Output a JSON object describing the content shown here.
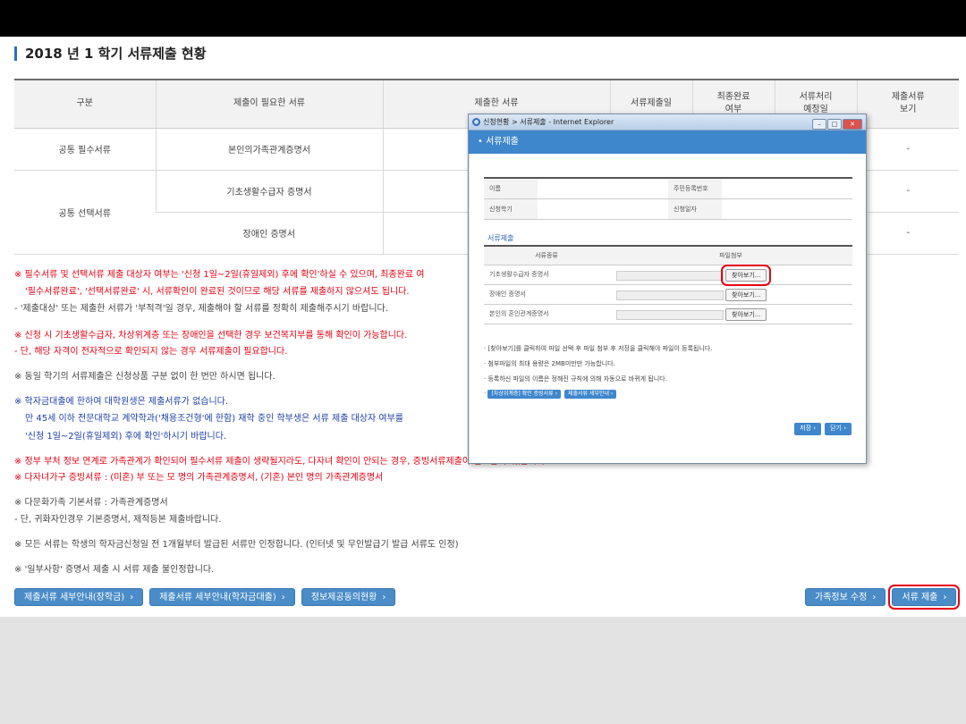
{
  "page": {
    "title": "2018 년 1 학기 서류제출 현황"
  },
  "table": {
    "headers": [
      "구분",
      "제출이 필요한 서류",
      "제출한 서류",
      "서류제출일",
      "최종완료\n여부",
      "서류처리\n예정일",
      "제출서류\n보기"
    ],
    "rows": [
      {
        "group": "공통 필수서류",
        "doc": "본인의가족관계증명서",
        "view": "-"
      },
      {
        "group": "공통 선택서류",
        "doc": "기초생활수급자 증명서",
        "view": "-"
      },
      {
        "group": "",
        "doc": "장애인 증명서",
        "view": "-"
      }
    ]
  },
  "notes": [
    {
      "text": "※ 필수서류 및 선택서류 제출 대상자 여부는 '신청 1일~2일(휴일제외) 후에 확인'하실 수 있으며, 최종완료 여",
      "color": "red"
    },
    {
      "text": "'필수서류완료', '선택서류완료' 시, 서류확인이 완료된 것이므로 해당 서류를 제출하지 않으셔도 됩니다.",
      "color": "red"
    },
    {
      "text": "- '제출대상' 또는 제출한 서류가 '부적격'일 경우, 제출해야 할 서류를 정확히 제출해주시기 바랍니다.",
      "color": "dark"
    },
    {
      "text": "※ 신청 시 기초생활수급자, 차상위계층 또는 장애인을 선택한 경우 보건복지부를 통해 확인이 가능합니다.",
      "color": "red"
    },
    {
      "text": "- 단, 해당 자격이 전자적으로 확인되지 않는 경우 서류제출이 필요합니다.",
      "color": "red"
    },
    {
      "text": "※ 동일 학기의 서류제출은 신청상품 구분 없이 한 번만 하시면 됩니다.",
      "color": "dark"
    },
    {
      "text": "※ 학자금대출에 한하여 대학원생은 제출서류가 없습니다.",
      "color": "blue"
    },
    {
      "text": "만 45세 이하 전문대학교 계약학과('채용조건형'에 한함) 재학 중인 학부생은 서류 제출 대상자 여부를",
      "color": "blue"
    },
    {
      "text": "'신청 1일~2일(휴일제외) 후에 확인'하시기 바랍니다.",
      "color": "blue"
    },
    {
      "text": "※ 정부 부처 정보 연계로 가족관계가 확인되어 필수서류 제출이 생략될지라도, 다자녀 확인이 안되는 경우, 증빙서류제출이 필요할 수 있습니다",
      "color": "red"
    },
    {
      "text": "※ 다자녀가구 증빙서류 : (미혼) 부 또는 모 명의 가족관계증명서, (기혼) 본인 명의 가족관계증명서",
      "color": "red"
    },
    {
      "text": "※ 다문화가족 기본서류 : 가족관계증명서",
      "color": "dark"
    },
    {
      "text": "- 단, 귀화자인경우 기본증명서, 제적등본 제출바랍니다.",
      "color": "dark"
    },
    {
      "text": "※ 모든 서류는 학생의 학자금신청일 전 1개월부터 발급된 서류만 인정합니다. (인터넷 및 무인발급기 발급 서류도 인정)",
      "color": "dark"
    },
    {
      "text": "※ '일부사항' 증명서 제출 시 서류 제출 불인정합니다.",
      "color": "dark"
    }
  ],
  "bottom_left_buttons": [
    "제출서류 세부안내(장학금)",
    "제출서류 세부안내(학자금대출)",
    "정보제공동의현황"
  ],
  "bottom_right_buttons": [
    "가족정보 수정",
    "서류 제출"
  ],
  "popup": {
    "window_title": "신청현황 > 서류제출 - Internet Explorer",
    "header": "서류제출",
    "info": {
      "name_label": "이름",
      "rrn_label": "주민등록번호",
      "term_label": "신청학기",
      "date_label": "신청일자"
    },
    "section_title": "서류제출",
    "file_headers": [
      "서류종류",
      "파일첨부"
    ],
    "files": [
      "기초생활수급자 증명서",
      "장애인 증명서",
      "본인의 혼인관계증명서"
    ],
    "browse_label": "찾아보기...",
    "guide": [
      "[찾아보기]를 클릭하여 파일 선택 후 파일 첨부 후 저장을 클릭해야 파일이 등록됩니다.",
      "첨부파일의 최대 용량은 2MB미만만 가능합니다.",
      "등록하신 파일의 이름은 정해진 규칙에 의해 자동으로 바뀌게 됩니다."
    ],
    "links": [
      "[차상위계층] 확인 증빙서류",
      "제출서류 세부안내"
    ],
    "save_label": "저장",
    "close_label": "닫기"
  }
}
